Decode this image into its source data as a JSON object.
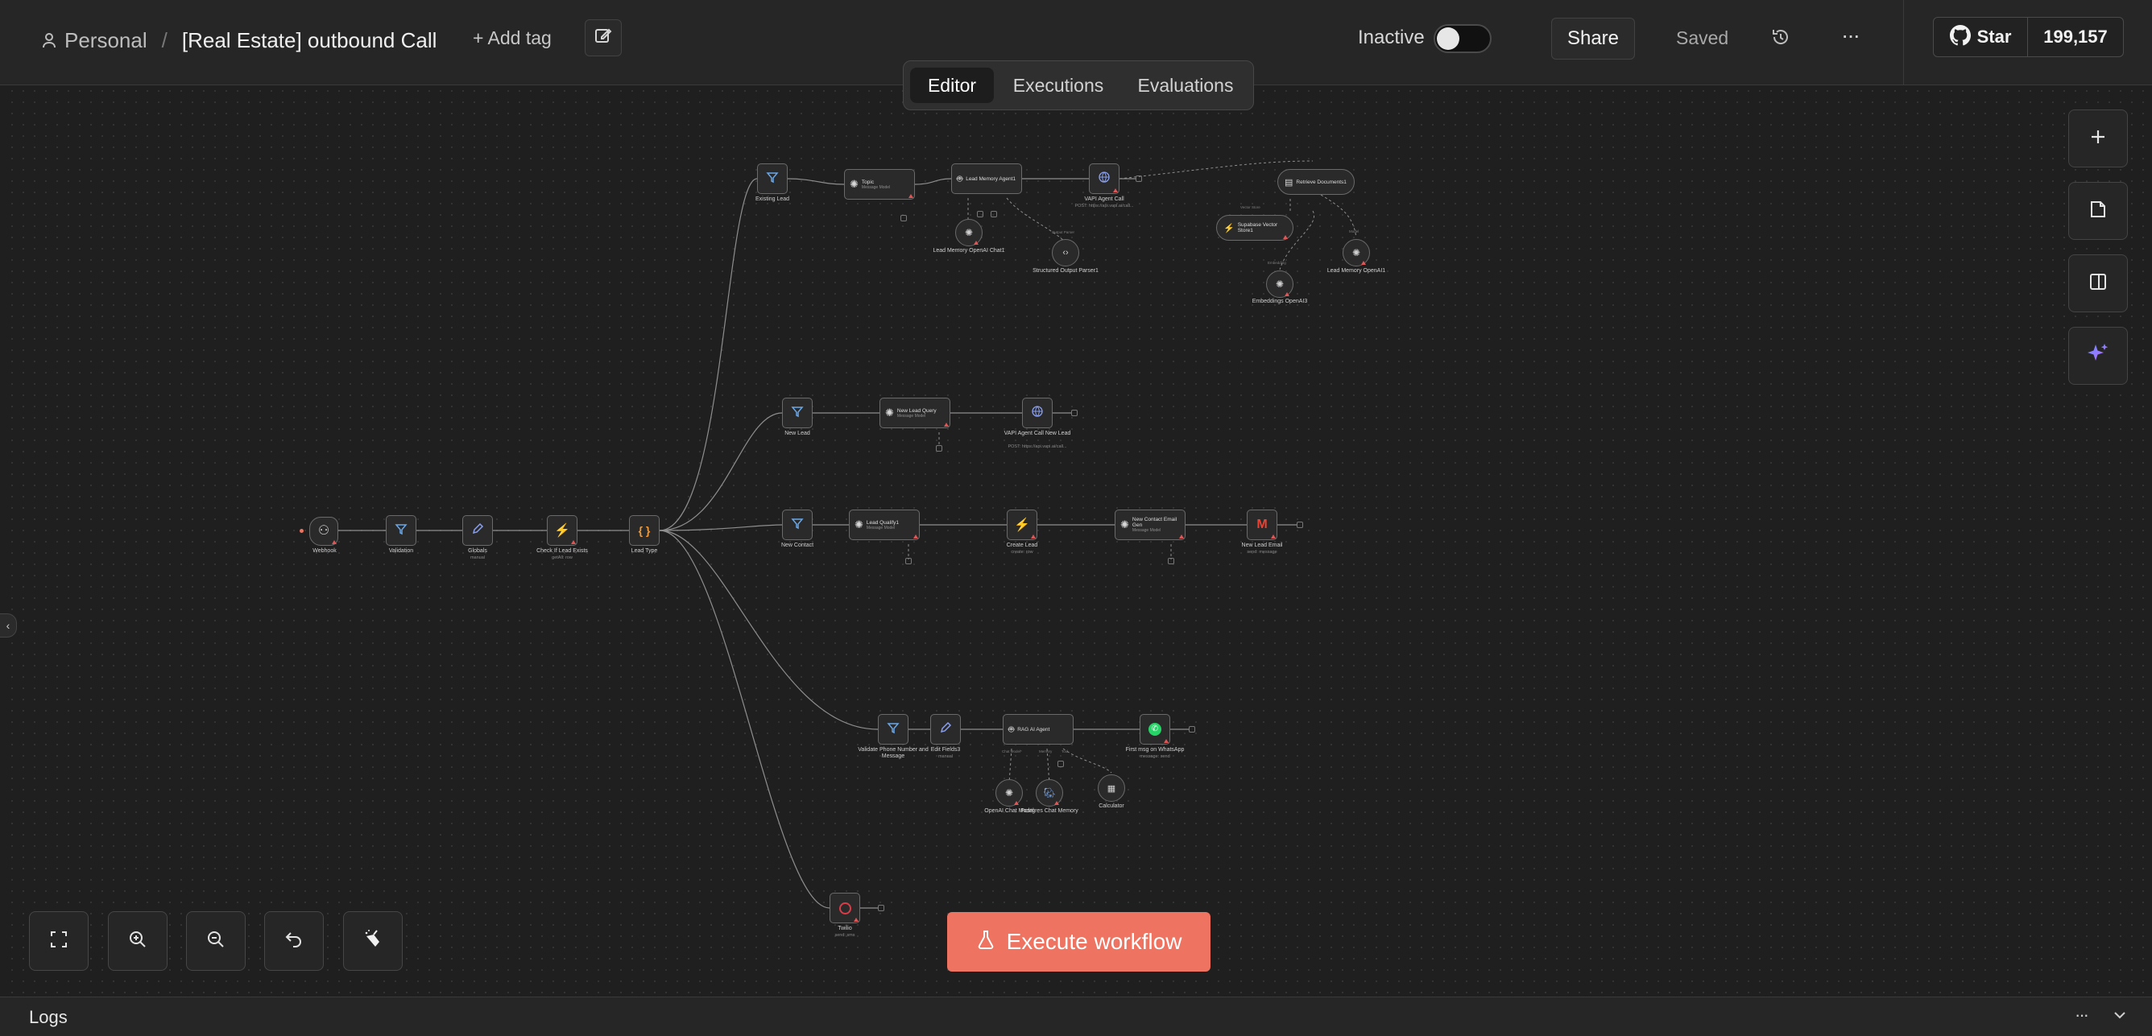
{
  "header": {
    "project": "Personal",
    "separator": "/",
    "workflow_name": "[Real Estate] outbound Call",
    "add_tag": "+ Add tag",
    "status_label": "Inactive",
    "share": "Share",
    "saved": "Saved",
    "more": "···",
    "github_star": "Star",
    "github_count": "199,157"
  },
  "tabs": [
    {
      "label": "Editor",
      "active": true
    },
    {
      "label": "Executions",
      "active": false
    },
    {
      "label": "Evaluations",
      "active": false
    }
  ],
  "execute_label": "Execute workflow",
  "logs": {
    "title": "Logs",
    "more": "···"
  },
  "nodes": {
    "webhook": {
      "label": "Webhook"
    },
    "validation": {
      "label": "Validation"
    },
    "globals": {
      "label": "Globals",
      "sub": "manual"
    },
    "check_exists": {
      "label": "Check If Lead Exists",
      "sub": "getAll: row"
    },
    "lead_type": {
      "label": "Lead Type"
    },
    "existing_lead": {
      "label": "Existing Lead"
    },
    "topic": {
      "label": "Topic",
      "sub": "Message Model"
    },
    "lead_memory_agent": {
      "label": "Lead Memory Agent1"
    },
    "vapi_call": {
      "label": "VAPI Agent Call",
      "sub": "POST: https://api.vapi.ai/call..."
    },
    "retrieve_docs": {
      "label": "Retrieve Documents1"
    },
    "supabase_store": {
      "label": "Supabase Vector Store1"
    },
    "embeddings": {
      "label": "Embeddings OpenAI3"
    },
    "lead_memory_openai1": {
      "label": "Lead Memory OpenAI1"
    },
    "lead_memory_chat": {
      "label": "Lead Memory OpenAI Chat1"
    },
    "structured_parser": {
      "label": "Structured Output Parser1"
    },
    "new_lead": {
      "label": "New Lead"
    },
    "new_lead_query": {
      "label": "New Lead Query",
      "sub": "Message Model"
    },
    "vapi_new_lead": {
      "label": "VAPI Agent Call New Lead",
      "sub": "POST: https://api.vapi.ai/call..."
    },
    "new_contact": {
      "label": "New Contact"
    },
    "lead_qualify": {
      "label": "Lead Qualify1",
      "sub": "Message Model"
    },
    "create_lead": {
      "label": "Create Lead",
      "sub": "create: row"
    },
    "new_contact_email": {
      "label": "New Contact Email Gen",
      "sub": "Message Model"
    },
    "new_lead_email": {
      "label": "New Lead Email",
      "sub": "send: message"
    },
    "validate_phone": {
      "label": "Validate Phone Number and Message"
    },
    "edit_fields": {
      "label": "Edit Fields3",
      "sub": "manual"
    },
    "rag_agent": {
      "label": "RAG AI Agent"
    },
    "whatsapp": {
      "label": "First msg on WhatsApp",
      "sub": "message: send"
    },
    "openai_chat": {
      "label": "OpenAI Chat Model"
    },
    "postgres_memory": {
      "label": "Postgres Chat Memory"
    },
    "calculator": {
      "label": "Calculator"
    },
    "twilio": {
      "label": "Twilio",
      "sub": "send: sms"
    }
  },
  "edge_labels": {
    "chat_model": "Chat Model*",
    "memory": "Memory",
    "tool": "Tool",
    "output_parser": "Output Parser",
    "vector_store": "Vector Store",
    "embedding": "Embedding",
    "model": "Model"
  },
  "colors": {
    "accent": "#ee7360",
    "canvas_bg": "#1f1f1f",
    "header_bg": "#262626"
  }
}
